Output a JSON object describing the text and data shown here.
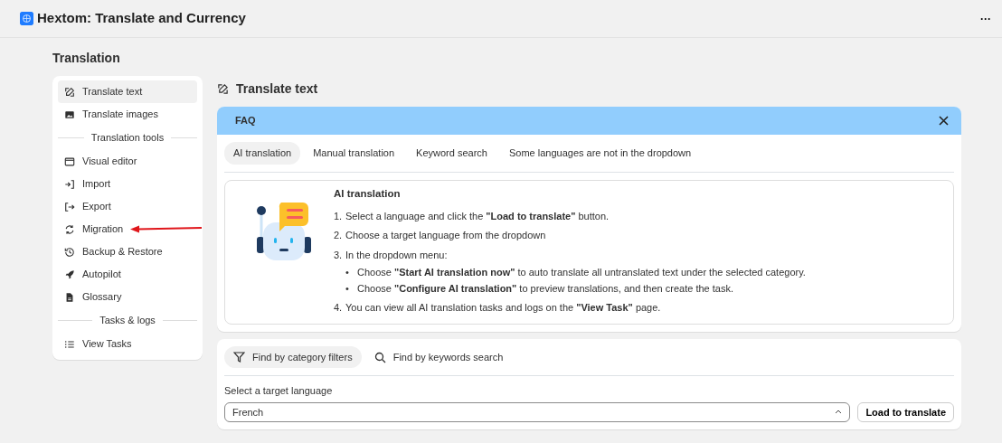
{
  "app": {
    "title": "Hextom: Translate and Currency",
    "menu_label": "···"
  },
  "page_title": "Translation",
  "sidebar": {
    "items": [
      {
        "kind": "item",
        "label": "Translate text",
        "selected": true,
        "annotated": false
      },
      {
        "kind": "item",
        "label": "Translate images",
        "selected": false,
        "annotated": false
      },
      {
        "kind": "heading",
        "label": "Translation tools"
      },
      {
        "kind": "item",
        "label": "Visual editor",
        "selected": false,
        "annotated": false
      },
      {
        "kind": "item",
        "label": "Import",
        "selected": false,
        "annotated": false
      },
      {
        "kind": "item",
        "label": "Export",
        "selected": false,
        "annotated": false
      },
      {
        "kind": "item",
        "label": "Migration",
        "selected": false,
        "annotated": true
      },
      {
        "kind": "item",
        "label": "Backup & Restore",
        "selected": false,
        "annotated": false
      },
      {
        "kind": "item",
        "label": "Autopilot",
        "selected": false,
        "annotated": false
      },
      {
        "kind": "item",
        "label": "Glossary",
        "selected": false,
        "annotated": false
      },
      {
        "kind": "heading",
        "label": "Tasks & logs"
      },
      {
        "kind": "item",
        "label": "View Tasks",
        "selected": false,
        "annotated": false
      }
    ]
  },
  "section_title": "Translate text",
  "faq": {
    "title": "FAQ",
    "tabs": [
      {
        "label": "AI translation",
        "selected": true
      },
      {
        "label": "Manual translation",
        "selected": false
      },
      {
        "label": "Keyword search",
        "selected": false
      },
      {
        "label": "Some languages are not in the dropdown",
        "selected": false
      }
    ],
    "panel": {
      "title": "AI translation",
      "steps": [
        {
          "number": "1.",
          "text": "Select a language and click the **\"Load to translate\"** button."
        },
        {
          "number": "2.",
          "text": "Choose a target language from the dropdown"
        },
        {
          "number": "3.",
          "text": "In the dropdown menu:",
          "children": [
            {
              "bullet": "•",
              "text": "Choose **\"Start AI translation now\"** to auto translate all untranslated text under the selected category."
            },
            {
              "bullet": "•",
              "text": "Choose **\"Configure AI translation\"** to preview translations, and then create the task."
            }
          ]
        },
        {
          "number": "4.",
          "text": "You can view all AI translation tasks and logs on the **\"View Task\"** page."
        }
      ]
    }
  },
  "finder": {
    "tabs": [
      {
        "label": "Find by category filters",
        "selected": true
      },
      {
        "label": "Find by keywords search",
        "selected": false
      }
    ],
    "language_label": "Select a target language",
    "language_value": "French",
    "load_button": "Load to translate"
  }
}
